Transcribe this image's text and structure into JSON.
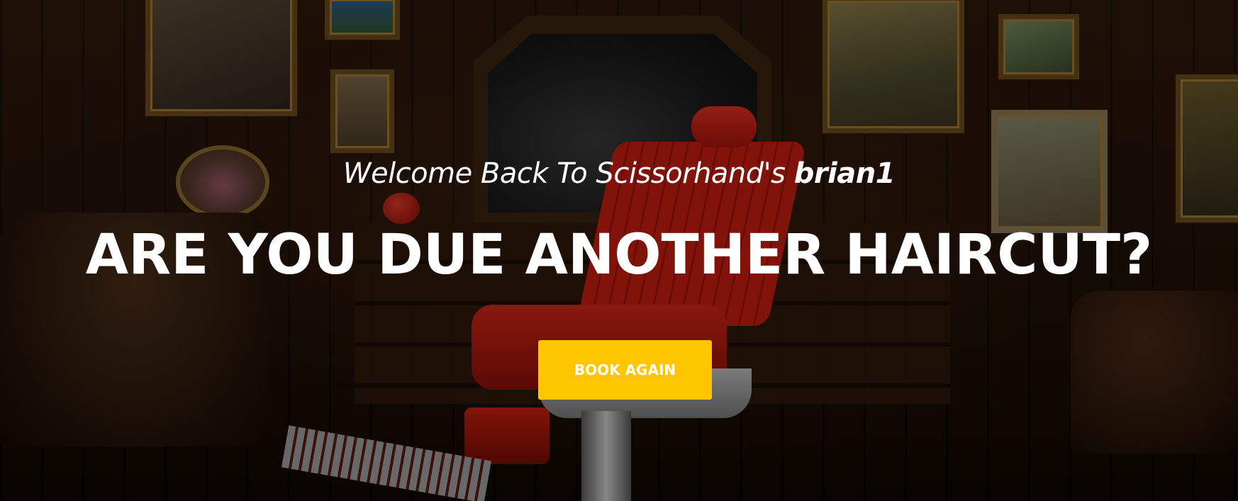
{
  "hero": {
    "welcome_text": "Welcome Back To Scissorhand's",
    "username": "brian1",
    "headline": "ARE YOU DUE ANOTHER HAIRCUT?",
    "cta_label": "BOOK AGAIN"
  },
  "colors": {
    "cta_background": "#ffc500",
    "text": "#ffffff"
  }
}
